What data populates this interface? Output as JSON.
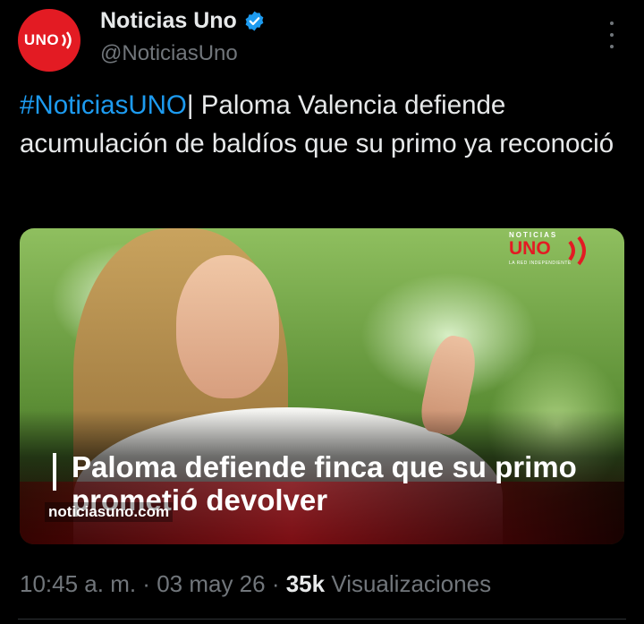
{
  "author": {
    "display_name": "Noticias Uno",
    "handle": "@NoticiasUno",
    "avatar_text": "UNO",
    "verified": true,
    "verified_color": "#1d9bf0"
  },
  "more_icon": "more-options-icon",
  "tweet": {
    "hashtag": "#NoticiasUNO",
    "body": "| Paloma Valencia defiende acumulación de baldíos que su primo ya reconoció"
  },
  "media": {
    "caption": "Paloma defiende finca que su primo prometió devolver",
    "site": "noticiasuno.com",
    "watermark_top": "NOTICIAS",
    "watermark_brand": "UNO",
    "watermark_sub": "LA RED INDEPENDIENTE"
  },
  "meta": {
    "time": "10:45 a. m.",
    "date": "03 may 26",
    "separator": " · ",
    "views_count": "35k",
    "views_label": "Visualizaciones"
  },
  "colors": {
    "background": "#000000",
    "text": "#e7e9ea",
    "secondary": "#71767b",
    "link": "#1d9bf0",
    "brand": "#e31b23"
  }
}
